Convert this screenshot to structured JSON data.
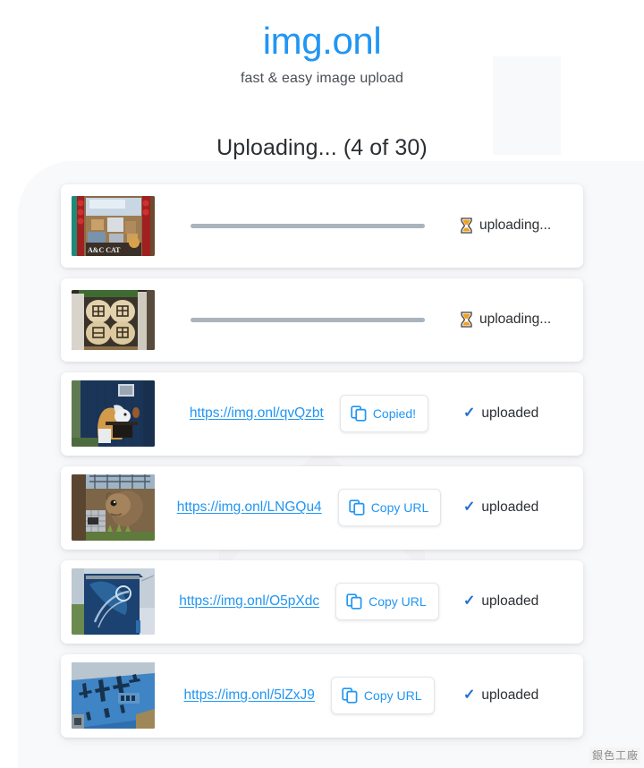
{
  "header": {
    "logo": "img.onl",
    "tagline": "fast & easy image upload"
  },
  "status_title": "Uploading... (4 of 30)",
  "labels": {
    "uploading": "uploading...",
    "uploaded": "uploaded",
    "check_glyph": "✓",
    "hourglass_icon": "hourglass-icon"
  },
  "uploads": [
    {
      "thumb_name": "thumbnail-antique-shop",
      "thumb_alt": "A&C CAT antique shop storefront",
      "state": "uploading",
      "status_text": "uploading...",
      "url": "",
      "button_label": "",
      "progress_percent": 100
    },
    {
      "thumb_name": "thumbnail-wooden-plaques",
      "thumb_alt": "Four carved wooden plaques",
      "state": "uploading",
      "status_text": "uploading...",
      "url": "",
      "button_label": "",
      "progress_percent": 100
    },
    {
      "thumb_name": "thumbnail-cat-mural",
      "thumb_alt": "Orange cat mural on blue wall",
      "state": "uploaded",
      "status_text": "uploaded",
      "url": "https://img.onl/qvQzbt",
      "button_label": "Copied!",
      "button_state": "copied"
    },
    {
      "thumb_name": "thumbnail-squirrel-mural",
      "thumb_alt": "Squirrel mural on building",
      "state": "uploaded",
      "status_text": "uploaded",
      "url": "https://img.onl/LNGQu4",
      "button_label": "Copy URL",
      "button_state": "idle"
    },
    {
      "thumb_name": "thumbnail-blue-wall-mural",
      "thumb_alt": "Blue painted wall mural",
      "state": "uploaded",
      "status_text": "uploaded",
      "url": "https://img.onl/O5pXdc",
      "button_label": "Copy URL",
      "button_state": "idle"
    },
    {
      "thumb_name": "thumbnail-blue-calligraphy",
      "thumb_alt": "Blue wall with Chinese calligraphy",
      "state": "uploaded",
      "status_text": "uploaded",
      "url": "https://img.onl/5lZxJ9",
      "button_label": "Copy URL",
      "button_state": "idle"
    }
  ],
  "watermark": [
    "銀",
    "色",
    "工",
    "廠"
  ],
  "colors": {
    "brand_blue": "#2196f3",
    "link_blue": "#2196f3",
    "page_bg": "#ffffff",
    "panel_bg": "#f8f9fa",
    "progress_track": "#aab4bd",
    "check_blue": "#1f6fd0"
  }
}
